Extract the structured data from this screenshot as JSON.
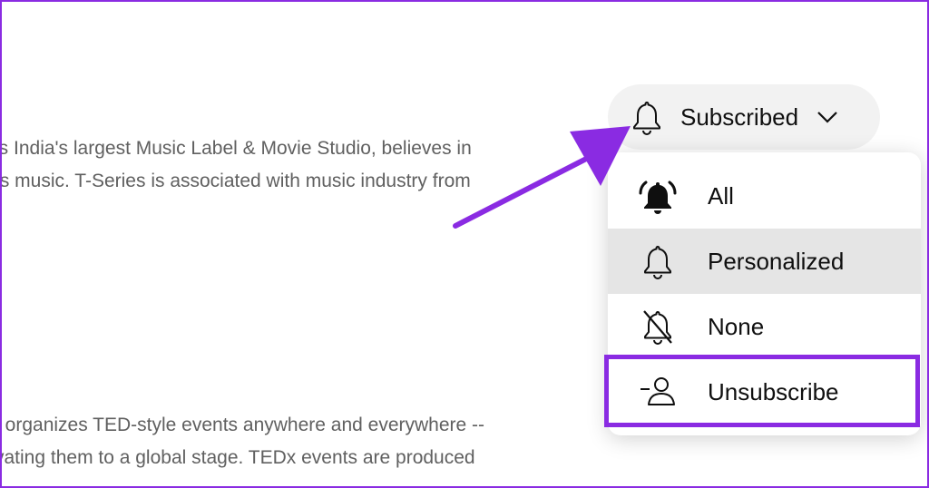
{
  "description": {
    "lines_top": [
      "is India's largest Music Label & Movie Studio, believes in",
      "ts music. T-Series is associated with music industry from"
    ],
    "lines_bottom": [
      "t organizes TED-style events anywhere and everywhere --",
      "vating them to a global stage. TEDx events are produced"
    ]
  },
  "subscribe_button": {
    "label": "Subscribed",
    "icon": "bell-outline-icon"
  },
  "notification_menu": {
    "items": [
      {
        "label": "All",
        "icon": "bell-ringing-icon"
      },
      {
        "label": "Personalized",
        "icon": "bell-outline-icon",
        "selected": true
      },
      {
        "label": "None",
        "icon": "bell-off-icon"
      },
      {
        "label": "Unsubscribe",
        "icon": "person-minus-icon"
      }
    ]
  },
  "colors": {
    "accent": "#8a2be2",
    "selected_bg": "#e5e5e5",
    "button_bg": "#f2f2f2"
  }
}
